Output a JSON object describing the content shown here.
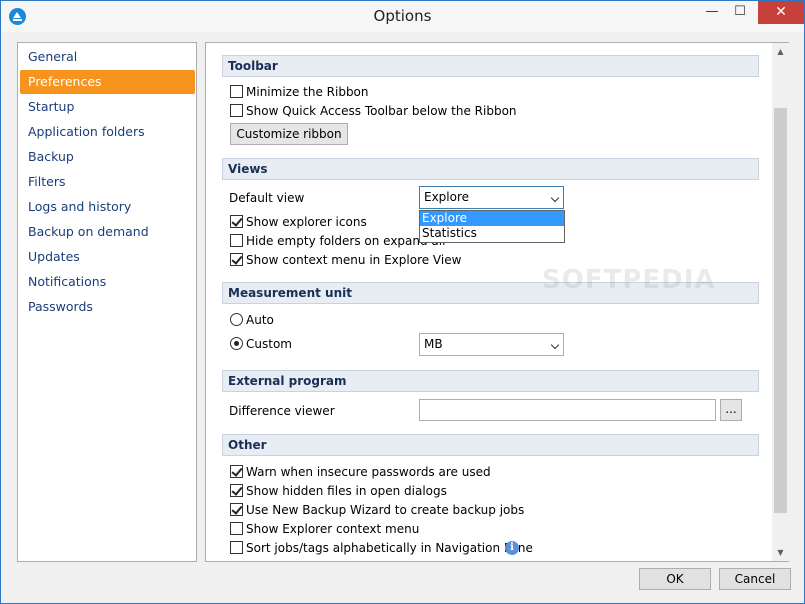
{
  "window": {
    "title": "Options",
    "icons": {
      "app": "app-logo-icon",
      "minimize": "minimize-icon",
      "maximize": "maximize-icon",
      "close": "close-icon"
    },
    "glyphs": {
      "minimize": "—",
      "maximize": "☐",
      "close": "✕"
    }
  },
  "sidebar": {
    "items": [
      {
        "label": "General"
      },
      {
        "label": "Preferences",
        "active": true
      },
      {
        "label": "Startup"
      },
      {
        "label": "Application folders"
      },
      {
        "label": "Backup"
      },
      {
        "label": "Filters"
      },
      {
        "label": "Logs and history"
      },
      {
        "label": "Backup on demand"
      },
      {
        "label": "Updates"
      },
      {
        "label": "Notifications"
      },
      {
        "label": "Passwords"
      }
    ],
    "active_color": "#f7941d"
  },
  "toolbar_section": {
    "heading": "Toolbar",
    "minimize_ribbon": {
      "label": "Minimize the Ribbon",
      "checked": false
    },
    "show_qat_below": {
      "label": "Show Quick Access Toolbar below the Ribbon",
      "checked": false
    },
    "customize_button": "Customize ribbon"
  },
  "views_section": {
    "heading": "Views",
    "default_view_label": "Default view",
    "default_view_value": "Explore",
    "default_view_options": [
      "Explore",
      "Statistics"
    ],
    "show_explorer_icons": {
      "label": "Show explorer icons",
      "checked": true
    },
    "hide_empty_folders": {
      "label": "Hide empty folders on expand all",
      "checked": false
    },
    "show_context_menu": {
      "label": "Show context menu in Explore View",
      "checked": true
    }
  },
  "measurement_section": {
    "heading": "Measurement unit",
    "auto": {
      "label": "Auto",
      "selected": false
    },
    "custom": {
      "label": "Custom",
      "selected": true
    },
    "unit_value": "MB"
  },
  "external_section": {
    "heading": "External program",
    "difference_viewer_label": "Difference viewer",
    "difference_viewer_value": "",
    "browse_button": "..."
  },
  "other_section": {
    "heading": "Other",
    "warn_insecure": {
      "label": "Warn when insecure passwords are used",
      "checked": true
    },
    "show_hidden_files": {
      "label": "Show hidden files in open dialogs",
      "checked": true
    },
    "use_new_wizard": {
      "label": "Use New Backup Wizard to create backup jobs",
      "checked": true
    },
    "show_explorer_context": {
      "label": "Show Explorer context menu",
      "checked": false
    },
    "sort_jobs": {
      "label": "Sort jobs/tags alphabetically in Navigation Pane",
      "checked": false
    },
    "info_icon": "info-icon",
    "info_glyph": "i"
  },
  "scrollbar": {
    "up_glyph": "▲",
    "down_glyph": "▼"
  },
  "watermark": "SOFTPEDIA",
  "footer": {
    "ok": "OK",
    "cancel": "Cancel"
  }
}
